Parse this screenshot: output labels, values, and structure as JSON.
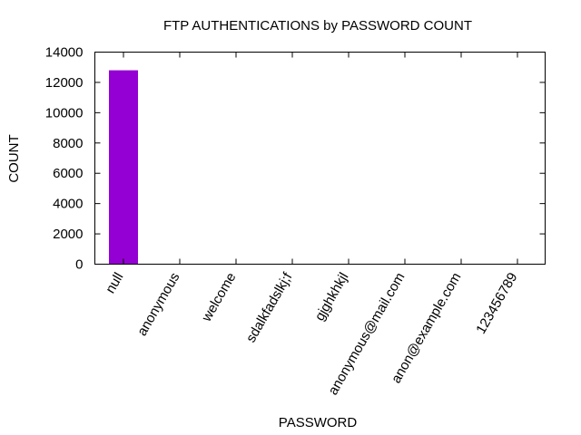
{
  "chart_data": {
    "type": "bar",
    "title": "FTP AUTHENTICATIONS by PASSWORD COUNT",
    "xlabel": "PASSWORD",
    "ylabel": "COUNT",
    "categories": [
      "null",
      "anonymous",
      "welcome",
      "sdalkfadslkj;f",
      "gjghkhkjl",
      "anonymous@mail.com",
      "anon@example.com",
      "123456789"
    ],
    "series": [
      {
        "values": [
          12800,
          1,
          1,
          1,
          1,
          1,
          1,
          1
        ]
      }
    ],
    "ylim": [
      0,
      14000
    ],
    "yticks": [
      0,
      2000,
      4000,
      6000,
      8000,
      10000,
      12000,
      14000
    ],
    "bar_color": "#9400d3",
    "grid": false,
    "legend": "none"
  }
}
